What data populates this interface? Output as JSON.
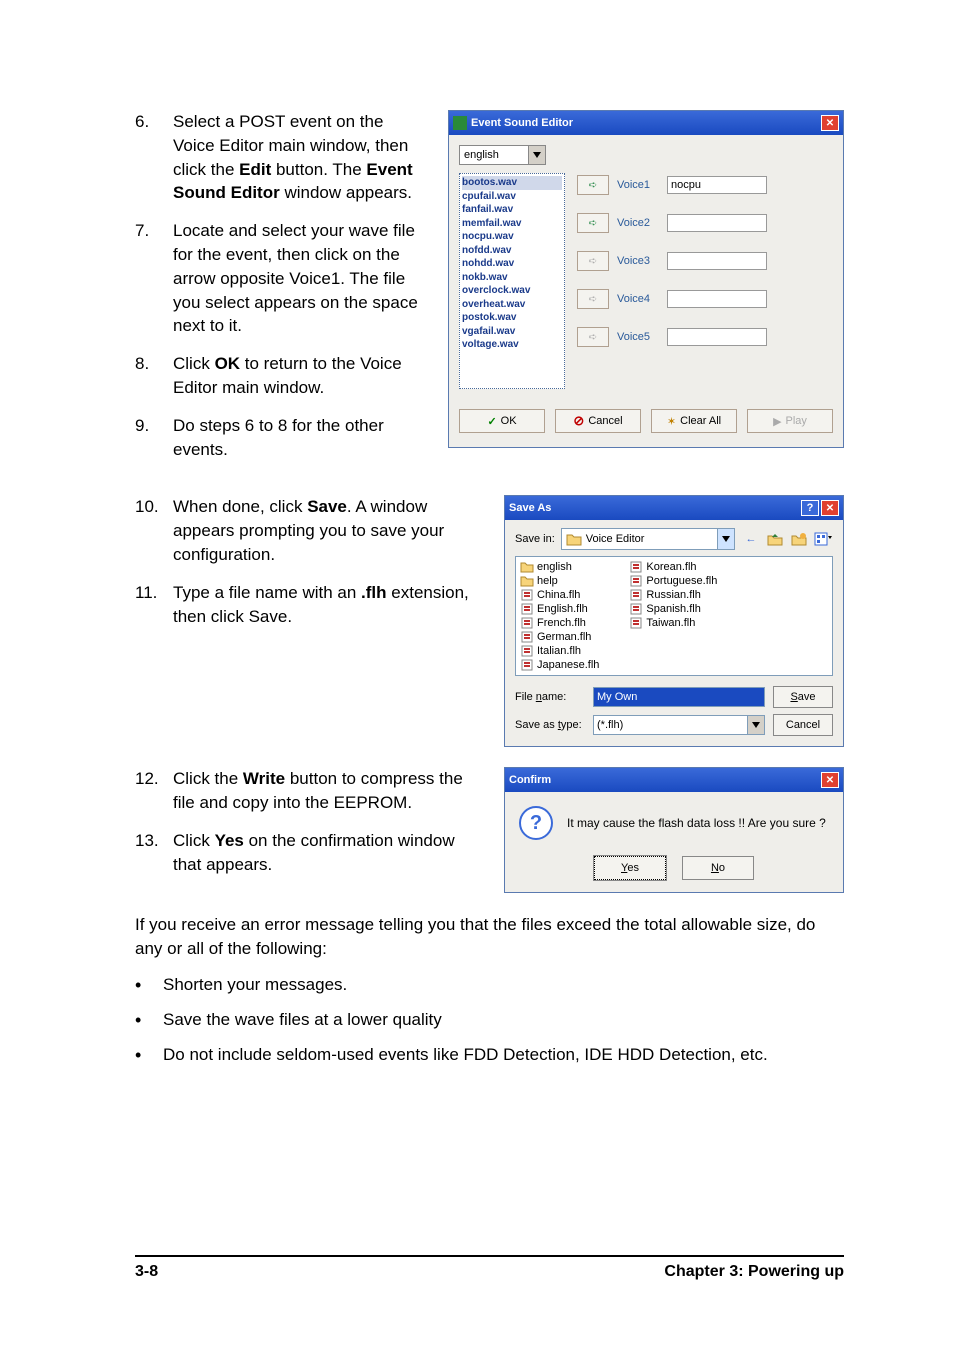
{
  "steps_a": [
    {
      "n": "6.",
      "html": "Select a POST event on the Voice Editor main window, then click the <b>Edit</b> button. The <b>Event Sound Editor</b> window appears."
    },
    {
      "n": "7.",
      "html": "Locate and select your wave file for the event, then click on the arrow opposite Voice1. The file you select appears on the space next to it."
    },
    {
      "n": "8.",
      "html": "Click <b>OK</b> to return to the Voice Editor main window."
    },
    {
      "n": "9.",
      "html": "Do steps 6 to 8 for the other events."
    }
  ],
  "steps_b": [
    {
      "n": "10.",
      "html": "When done, click <b>Save</b>. A window appears prompting you to save your configuration."
    },
    {
      "n": "11.",
      "html": "Type a file name with an <b>.flh</b> extension, then click Save."
    }
  ],
  "steps_c": [
    {
      "n": "12.",
      "html": "Click the <b>Write</b> button to compress the file and copy into the EEPROM."
    },
    {
      "n": "13.",
      "html": "Click <b>Yes</b> on the confirmation window that appears."
    }
  ],
  "para": "If you receive an error message telling you that the files exceed the total allowable size, do any or all of the following:",
  "bullets": [
    "Shorten your messages.",
    "Save the wave files at a lower quality",
    "Do not include seldom-used events like FDD Detection, IDE HDD Detection, etc."
  ],
  "footer": {
    "page": "3-8",
    "chapter": "Chapter 3: Powering up"
  },
  "ese": {
    "title": "Event Sound Editor",
    "lang": "english",
    "wavs": [
      "bootos.wav",
      "cpufail.wav",
      "fanfail.wav",
      "memfail.wav",
      "nocpu.wav",
      "nofdd.wav",
      "nohdd.wav",
      "nokb.wav",
      "overclock.wav",
      "overheat.wav",
      "postok.wav",
      "vgafail.wav",
      "voltage.wav"
    ],
    "voices": [
      {
        "label": "Voice1",
        "value": "nocpu",
        "enabled": true
      },
      {
        "label": "Voice2",
        "value": "",
        "enabled": true
      },
      {
        "label": "Voice3",
        "value": "",
        "enabled": false
      },
      {
        "label": "Voice4",
        "value": "",
        "enabled": false
      },
      {
        "label": "Voice5",
        "value": "",
        "enabled": false
      }
    ],
    "btns": {
      "ok": "OK",
      "cancel": "Cancel",
      "clear": "Clear All",
      "play": "Play"
    }
  },
  "saveas": {
    "title": "Save As",
    "savein_label": "Save in:",
    "folder": "Voice Editor",
    "files": [
      {
        "name": "english",
        "kind": "folder"
      },
      {
        "name": "help",
        "kind": "folder"
      },
      {
        "name": "China.flh",
        "kind": "flh"
      },
      {
        "name": "English.flh",
        "kind": "flh"
      },
      {
        "name": "French.flh",
        "kind": "flh"
      },
      {
        "name": "German.flh",
        "kind": "flh"
      },
      {
        "name": "Italian.flh",
        "kind": "flh"
      },
      {
        "name": "Japanese.flh",
        "kind": "flh"
      },
      {
        "name": "Korean.flh",
        "kind": "flh"
      },
      {
        "name": "Portuguese.flh",
        "kind": "flh"
      },
      {
        "name": "Russian.flh",
        "kind": "flh"
      },
      {
        "name": "Spanish.flh",
        "kind": "flh"
      },
      {
        "name": "Taiwan.flh",
        "kind": "flh"
      }
    ],
    "filename_label": "File name:",
    "filename": "My Own",
    "type_label": "Save as type:",
    "type": "(*.flh)",
    "save": "Save",
    "cancel": "Cancel"
  },
  "confirm": {
    "title": "Confirm",
    "msg": "It may cause the flash data loss !!  Are you sure ?",
    "yes": "Yes",
    "no": "No"
  }
}
